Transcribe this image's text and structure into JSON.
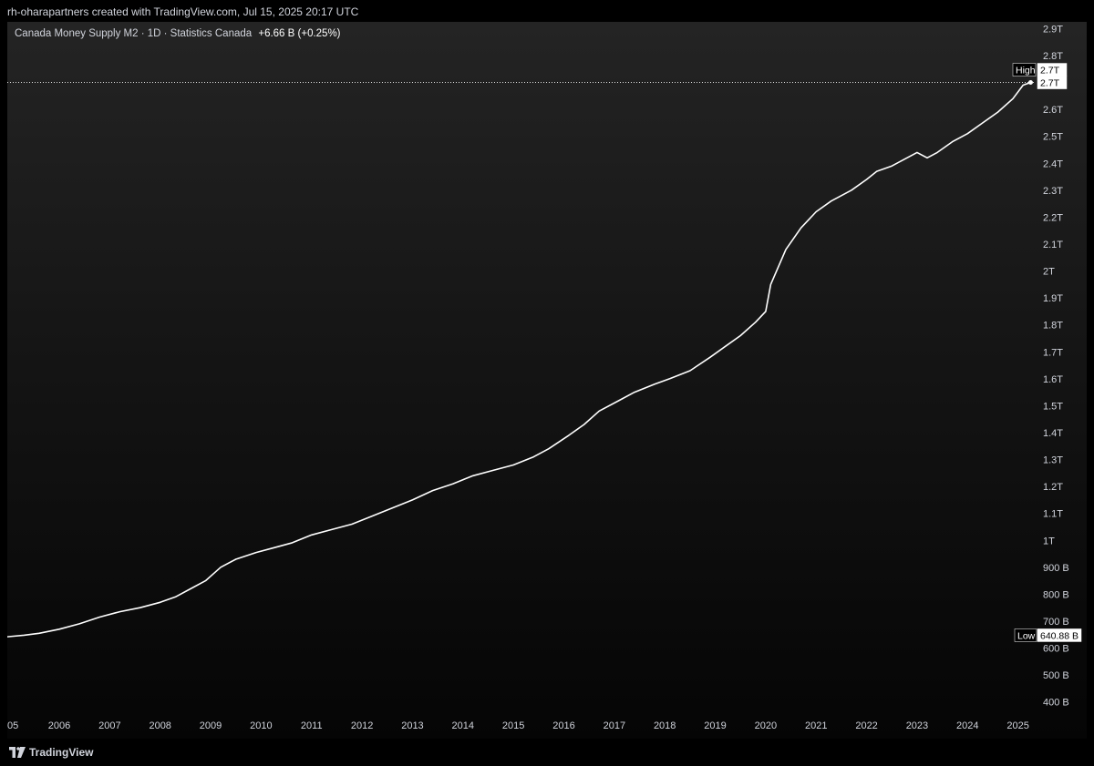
{
  "header": {
    "credit": "rh-oharapartners created with TradingView.com, Jul 15, 2025 20:17 UTC"
  },
  "legend": {
    "title": "Canada Money Supply M2 · 1D · Statistics Canada",
    "change": "+6.66 B (+0.25%)"
  },
  "footer": {
    "brand": "TradingView"
  },
  "colors": {
    "line": "#ffffff",
    "text": "#d1d4dc",
    "background_top": "#242424",
    "background_bottom": "#050505"
  },
  "chart_data": {
    "type": "line",
    "series": [
      {
        "x": [
          2004.9,
          2005.3,
          2005.6,
          2006.0,
          2006.4,
          2006.8,
          2007.2,
          2007.6,
          2008.0,
          2008.3,
          2008.6,
          2008.9,
          2009.2,
          2009.5,
          2009.9,
          2010.3,
          2010.6,
          2011.0,
          2011.4,
          2011.8,
          2012.2,
          2012.6,
          2013.0,
          2013.4,
          2013.8,
          2014.2,
          2014.6,
          2015.0,
          2015.4,
          2015.7,
          2016.1,
          2016.4,
          2016.7,
          2017.1,
          2017.4,
          2017.8,
          2018.1,
          2018.5,
          2018.9,
          2019.2,
          2019.5,
          2019.8,
          2020.0,
          2020.1,
          2020.4,
          2020.7,
          2021.0,
          2021.3,
          2021.7,
          2022.0,
          2022.2,
          2022.5,
          2022.8,
          2023.0,
          2023.2,
          2023.4,
          2023.7,
          2024.0,
          2024.3,
          2024.6,
          2024.9,
          2025.1,
          2025.25
        ],
        "y": [
          640.88,
          648,
          655,
          670,
          690,
          715,
          735,
          750,
          770,
          790,
          820,
          850,
          900,
          930,
          955,
          975,
          990,
          1020,
          1040,
          1060,
          1090,
          1120,
          1150,
          1185,
          1210,
          1240,
          1260,
          1280,
          1310,
          1340,
          1390,
          1430,
          1480,
          1520,
          1550,
          1580,
          1600,
          1630,
          1680,
          1720,
          1760,
          1810,
          1850,
          1950,
          2080,
          2160,
          2220,
          2260,
          2300,
          2340,
          2370,
          2390,
          2420,
          2440,
          2420,
          2440,
          2480,
          2510,
          2550,
          2590,
          2640,
          2690,
          2700
        ]
      }
    ],
    "x_ticks": [
      "05",
      "2006",
      "2007",
      "2008",
      "2009",
      "2010",
      "2011",
      "2012",
      "2013",
      "2014",
      "2015",
      "2016",
      "2017",
      "2018",
      "2019",
      "2020",
      "2021",
      "2022",
      "2023",
      "2024",
      "2025"
    ],
    "x_tick_values": [
      2005,
      2006,
      2007,
      2008,
      2009,
      2010,
      2011,
      2012,
      2013,
      2014,
      2015,
      2016,
      2017,
      2018,
      2019,
      2020,
      2021,
      2022,
      2023,
      2024,
      2025
    ],
    "xlim": [
      2004.97,
      2025.35
    ],
    "y_ticks": [
      "400 B",
      "500 B",
      "600 B",
      "700 B",
      "800 B",
      "900 B",
      "1T",
      "1.1T",
      "1.2T",
      "1.3T",
      "1.4T",
      "1.5T",
      "1.6T",
      "1.7T",
      "1.8T",
      "1.9T",
      "2T",
      "2.1T",
      "2.2T",
      "2.3T",
      "2.4T",
      "2.5T",
      "2.6T",
      "2.7T",
      "2.8T",
      "2.9T"
    ],
    "y_tick_values": [
      400,
      500,
      600,
      700,
      800,
      900,
      1000,
      1100,
      1200,
      1300,
      1400,
      1500,
      1600,
      1700,
      1800,
      1900,
      2000,
      2100,
      2200,
      2300,
      2400,
      2500,
      2600,
      2700,
      2800,
      2900
    ],
    "ylim": [
      355,
      2925
    ],
    "markers": {
      "high": {
        "label": "High",
        "value_label": "2.7T",
        "value": 2700
      },
      "low": {
        "label": "Low",
        "value_label": "640.88 B",
        "value": 640.88
      },
      "last": {
        "value_label": "2.7T",
        "value": 2700
      }
    },
    "grid": false,
    "ylabel": "",
    "xlabel": ""
  }
}
